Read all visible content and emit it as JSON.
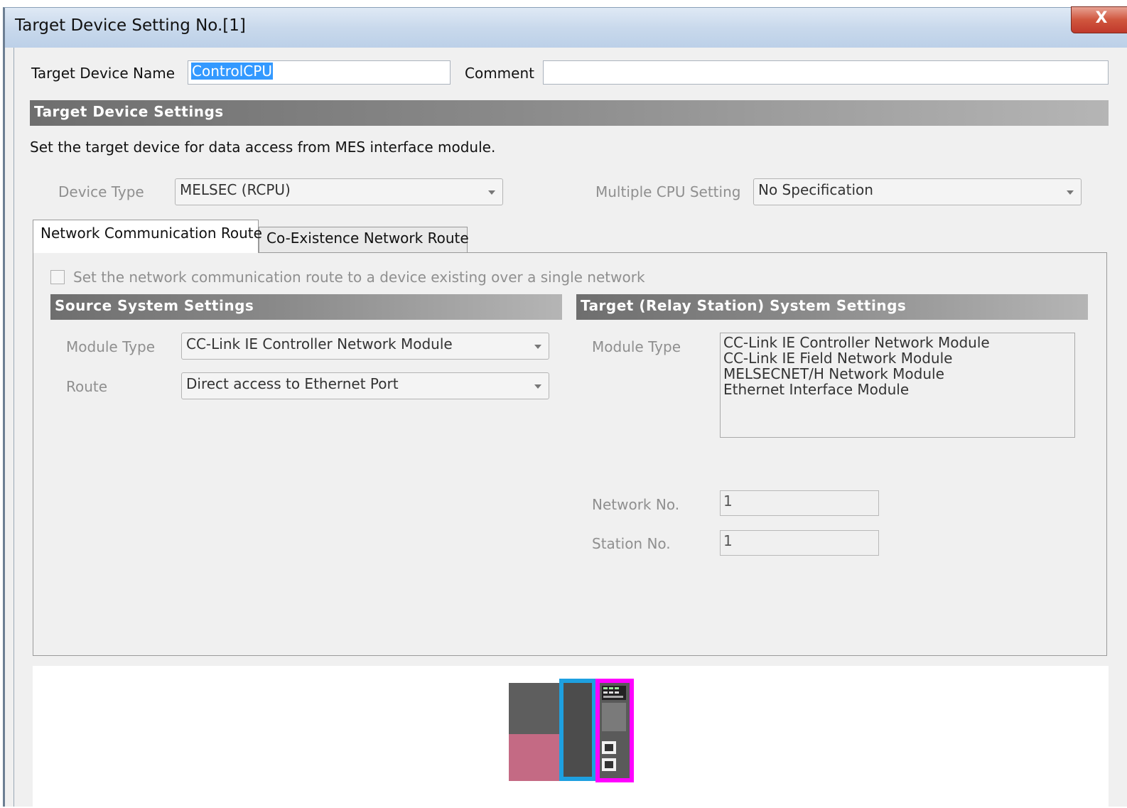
{
  "window": {
    "title": "Target Device Setting No.[1]",
    "close_label": "X"
  },
  "header": {
    "name_label": "Target Device Name",
    "name_value": "ControlCPU",
    "comment_label": "Comment",
    "comment_value": ""
  },
  "target_settings": {
    "heading": "Target Device Settings",
    "description": "Set the target device for data access from MES interface module.",
    "device_type_label": "Device Type",
    "device_type_value": "MELSEC (RCPU)",
    "multi_cpu_label": "Multiple CPU Setting",
    "multi_cpu_value": "No Specification"
  },
  "tabs": [
    {
      "label": "Network Communication Route",
      "active": true
    },
    {
      "label": "Co-Existence Network Route",
      "active": false
    }
  ],
  "route": {
    "single_network_checkbox": "Set the network communication route to a device existing over a single network",
    "single_network_checked": false,
    "source": {
      "heading": "Source System Settings",
      "module_type_label": "Module Type",
      "module_type_value": "CC-Link IE Controller Network Module",
      "route_label": "Route",
      "route_value": "Direct access to Ethernet Port"
    },
    "target": {
      "heading": "Target (Relay Station) System Settings",
      "module_type_label": "Module Type",
      "module_types": [
        "CC-Link IE Controller Network Module",
        "CC-Link IE Field Network Module",
        "MELSECNET/H Network Module",
        "Ethernet Interface Module"
      ],
      "network_no_label": "Network No.",
      "network_no_value": "1",
      "station_no_label": "Station No.",
      "station_no_value": "1"
    }
  },
  "colors": {
    "window_bg": "#f0f0f0",
    "section_bar": "#7a7a7a",
    "highlight_blue": "#1ea0e0",
    "highlight_magenta": "#ff00ff",
    "module_pink": "#c46a84"
  }
}
